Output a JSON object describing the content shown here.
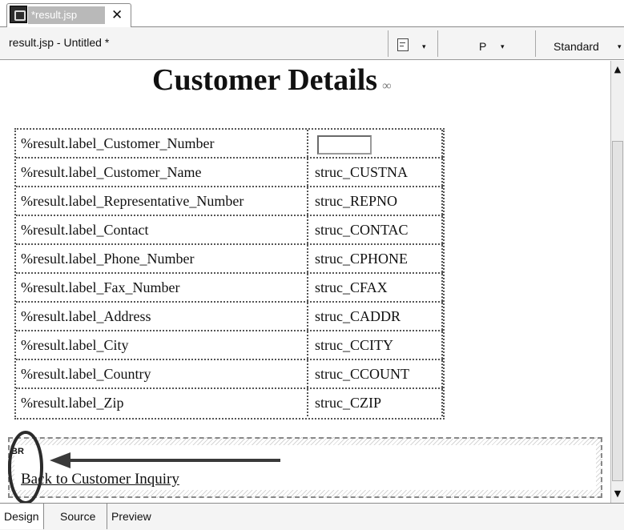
{
  "editor_tab": {
    "title": "*result.jsp",
    "close": "✕"
  },
  "toolbar": {
    "document_title": "result.jsp - Untitled *",
    "dropdown_arrow": "▾",
    "paragraph_style": "P",
    "font_style": "Standard"
  },
  "page": {
    "heading": "Customer Details",
    "fields": [
      {
        "label": "%result.label_Customer_Number",
        "value": ""
      },
      {
        "label": "%result.label_Customer_Name",
        "value": "struc_CUSTNA"
      },
      {
        "label": "%result.label_Representative_Number",
        "value": "struc_REPNO"
      },
      {
        "label": "%result.label_Contact",
        "value": "struc_CONTAC"
      },
      {
        "label": "%result.label_Phone_Number",
        "value": "struc_CPHONE"
      },
      {
        "label": "%result.label_Fax_Number",
        "value": "struc_CFAX"
      },
      {
        "label": "%result.label_Address",
        "value": "struc_CADDR"
      },
      {
        "label": "%result.label_City",
        "value": "struc_CCITY"
      },
      {
        "label": "%result.label_Country",
        "value": "struc_CCOUNT"
      },
      {
        "label": "%result.label_Zip",
        "value": "struc_CZIP"
      }
    ],
    "br_marker": "BR",
    "back_link": "Back to Customer Inquiry"
  },
  "bottom_tabs": {
    "design": "Design",
    "source": "Source",
    "preview": "Preview",
    "active": "Design"
  },
  "icons": {
    "tab": "jsp-file-icon",
    "paragraph": "paragraph-format-icon",
    "heading_marker": "link-marker-icon"
  }
}
